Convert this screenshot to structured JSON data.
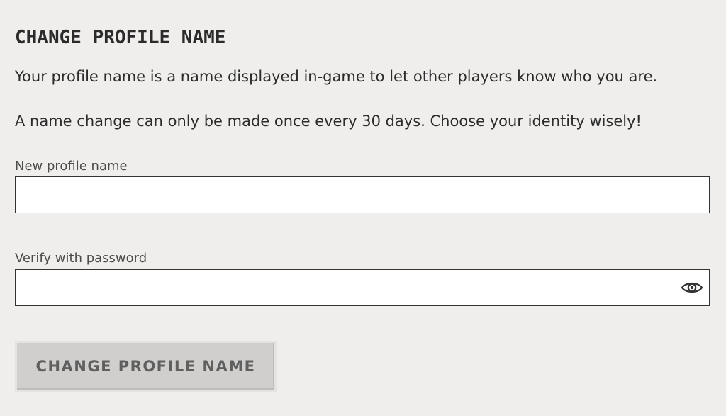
{
  "section": {
    "title": "CHANGE PROFILE NAME",
    "description_1": "Your profile name is a name displayed in-game to let other players know who you are.",
    "description_2": "A name change can only be made once every 30 days. Choose your identity wisely!"
  },
  "form": {
    "new_name": {
      "label": "New profile name",
      "value": "",
      "placeholder": ""
    },
    "password": {
      "label": "Verify with password",
      "value": "",
      "placeholder": "",
      "toggle_icon": "eye-icon"
    },
    "submit_label": "CHANGE PROFILE NAME"
  },
  "colors": {
    "background": "#f0eeed",
    "text": "#2b2b2b",
    "button_bg": "#d0cfce",
    "button_text": "#5f5f5f"
  }
}
